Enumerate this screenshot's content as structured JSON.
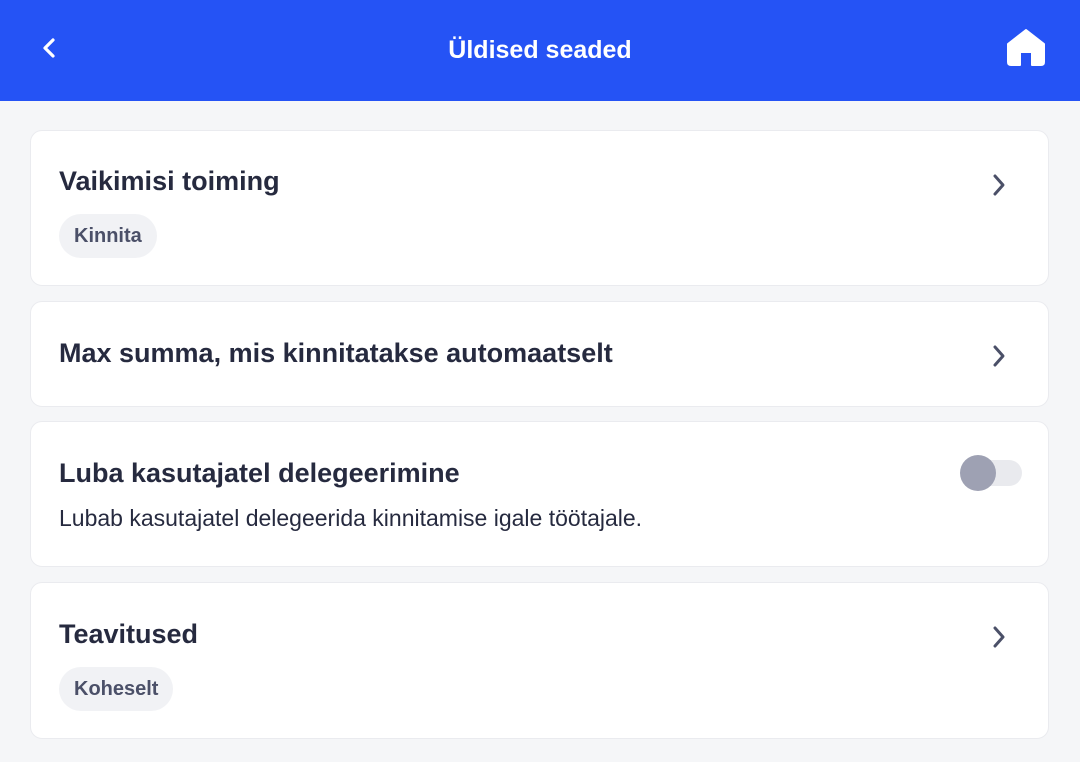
{
  "header": {
    "title": "Üldised seaded",
    "bg_color": "#2553f5",
    "back_icon": "chevron-left-icon",
    "home_icon": "home-icon"
  },
  "settings": [
    {
      "title": "Vaikimisi toiming",
      "value": "Kinnita",
      "type": "navigation"
    },
    {
      "title": "Max summa, mis kinnitatakse automaatselt",
      "type": "navigation"
    },
    {
      "title": "Luba kasutajatel delegeerimine",
      "description": "Lubab kasutajatel delegeerida kinnitamise igale töötajale.",
      "type": "toggle",
      "enabled": false
    },
    {
      "title": "Teavitused",
      "value": "Koheselt",
      "type": "navigation"
    }
  ]
}
